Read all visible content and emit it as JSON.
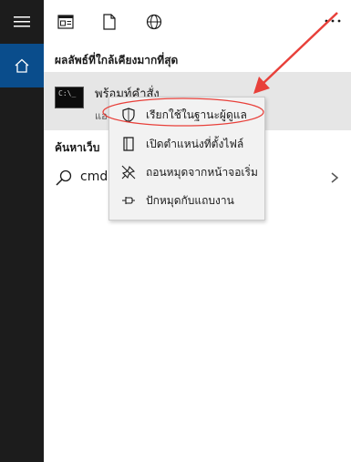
{
  "left_rail": {
    "icons": [
      "hamburger-icon",
      "home-icon"
    ]
  },
  "topbar": {
    "icons": [
      "apps-view-icon",
      "document-icon",
      "globe-icon"
    ],
    "more_label": "···"
  },
  "sections": {
    "best_match": "ผลลัพธ์ที่ใกล้เคียงมากที่สุด",
    "web": "ค้นหาเว็บ"
  },
  "best_match_item": {
    "name": "พร้อมท์คำสั่ง",
    "subtitle": "แอ",
    "icon_text": "C:\\_"
  },
  "web_item": {
    "query": "cmd"
  },
  "context_menu": {
    "items": [
      {
        "label": "เรียกใช้ในฐานะผู้ดูแล",
        "icon": "shield-icon"
      },
      {
        "label": "เปิดตำแหน่งที่ตั้งไฟล์",
        "icon": "file-location-icon"
      },
      {
        "label": "ถอนหมุดจากหน้าจอเริ่ม",
        "icon": "unpin-icon"
      },
      {
        "label": "ปักหมุดกับแถบงาน",
        "icon": "pin-icon"
      }
    ]
  },
  "colors": {
    "rail": "#1c1c1c",
    "active": "#0a4d8c",
    "annotation": "#e8403a",
    "highlight": "#e6e6e6"
  }
}
